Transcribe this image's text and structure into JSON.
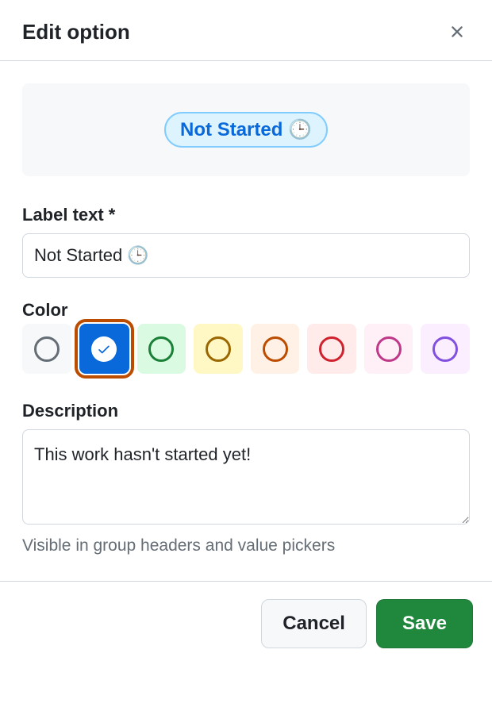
{
  "header": {
    "title": "Edit option"
  },
  "preview": {
    "chip_text": "Not Started 🕒"
  },
  "form": {
    "label_text": {
      "label": "Label text *",
      "value": "Not Started 🕒"
    },
    "color": {
      "label": "Color",
      "selected": "blue",
      "options": [
        {
          "name": "gray",
          "bg": "#f6f8fa",
          "ring": "#656d76"
        },
        {
          "name": "blue",
          "bg": "#0969da",
          "ring": "#ffffff"
        },
        {
          "name": "green",
          "bg": "#dafbe1",
          "ring": "#1a7f37"
        },
        {
          "name": "yellow",
          "bg": "#fff8c5",
          "ring": "#9a6700"
        },
        {
          "name": "orange",
          "bg": "#fff1e5",
          "ring": "#bc4c00"
        },
        {
          "name": "red",
          "bg": "#ffebe9",
          "ring": "#cf222e"
        },
        {
          "name": "pink",
          "bg": "#ffeff7",
          "ring": "#bf3989"
        },
        {
          "name": "purple",
          "bg": "#fbefff",
          "ring": "#8250df"
        }
      ]
    },
    "description": {
      "label": "Description",
      "value": "This work hasn't started yet!",
      "help": "Visible in group headers and value pickers"
    }
  },
  "footer": {
    "cancel_label": "Cancel",
    "save_label": "Save"
  }
}
